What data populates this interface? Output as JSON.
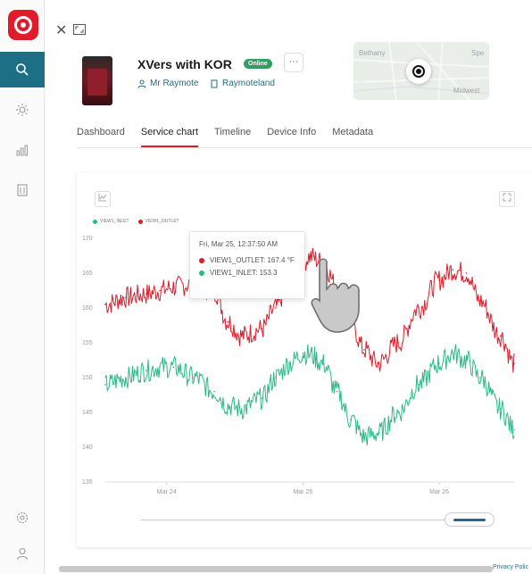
{
  "header": {
    "title": "XVers with KOR",
    "status_badge": "Online",
    "more_label": "···",
    "owner": "Mr Raymote",
    "location": "Raymoteland"
  },
  "map": {
    "labels": [
      "Bethany",
      "Midwest",
      "Spe"
    ]
  },
  "tabs": [
    {
      "label": "Dashboard",
      "active": false
    },
    {
      "label": "Service chart",
      "active": true
    },
    {
      "label": "Timeline",
      "active": false
    },
    {
      "label": "Device Info",
      "active": false
    },
    {
      "label": "Metadata",
      "active": false
    }
  ],
  "chart": {
    "legend": [
      {
        "name": "VIEW1_INLET",
        "color": "#2bb88a"
      },
      {
        "name": "VIEW1_OUTLET",
        "color": "#e01b2a"
      }
    ],
    "tooltip": {
      "timestamp": "Fri, Mar 25, 12:37:50 AM",
      "outlet_text": "VIEW1_OUTLET: 167.4 °F",
      "inlet_text": "VIEW1_INLET: 153.3"
    }
  },
  "chart_data": {
    "type": "line",
    "title": "",
    "xlabel": "",
    "ylabel": "",
    "ylim": [
      135,
      170
    ],
    "yticks": [
      135,
      140,
      145,
      150,
      155,
      160,
      165,
      170
    ],
    "xticks": [
      "Mar 24",
      "Mar 25",
      "Mar 26"
    ],
    "x_range_days": [
      23.55,
      26.55
    ],
    "grid": false,
    "legend_position": "top-left",
    "series": [
      {
        "name": "VIEW1_OUTLET",
        "color": "#e01b2a",
        "x": [
          23.55,
          23.7,
          23.85,
          23.95,
          24.05,
          24.2,
          24.35,
          24.45,
          24.55,
          24.7,
          24.8,
          24.9,
          25.0,
          25.05,
          25.15,
          25.25,
          25.35,
          25.45,
          25.55,
          25.7,
          25.85,
          26.0,
          26.1,
          26.2,
          26.3,
          26.45,
          26.55
        ],
        "y": [
          160.5,
          161.5,
          162,
          162.5,
          163,
          163.5,
          162.5,
          158,
          156,
          157,
          160,
          164,
          166.5,
          167.4,
          166.5,
          163,
          158,
          154,
          152,
          155,
          160,
          164,
          165.5,
          165,
          161,
          156,
          152
        ]
      },
      {
        "name": "VIEW1_INLET",
        "color": "#2bb88a",
        "x": [
          23.55,
          23.7,
          23.85,
          23.95,
          24.05,
          24.2,
          24.35,
          24.45,
          24.55,
          24.7,
          24.8,
          24.9,
          25.0,
          25.05,
          25.15,
          25.25,
          25.35,
          25.45,
          25.55,
          25.7,
          25.85,
          26.0,
          26.1,
          26.2,
          26.3,
          26.45,
          26.55
        ],
        "y": [
          149,
          150,
          151,
          151.5,
          151.5,
          150,
          148,
          146,
          145.5,
          147,
          150,
          152,
          153.5,
          153.3,
          152,
          148,
          144,
          141.5,
          142,
          145,
          149,
          152,
          153.5,
          152.5,
          150,
          145.5,
          142.5
        ]
      }
    ]
  },
  "footer": {
    "privacy": "Privacy Polic"
  }
}
